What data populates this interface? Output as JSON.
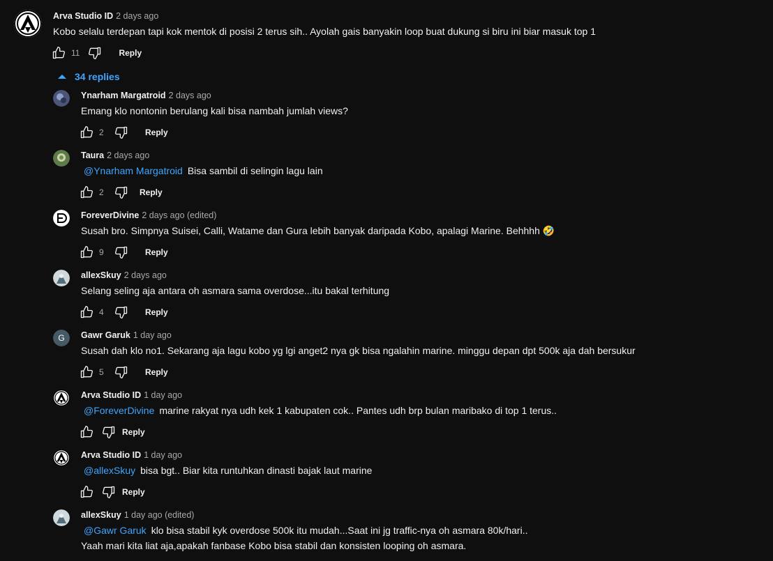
{
  "top_comment": {
    "author": "Arva Studio ID",
    "time": "2 days ago",
    "text": "Kobo selalu terdepan tapi kok mentok di posisi 2 terus sih.. Ayolah gais banyakin loop buat dukung si biru ini biar masuk top 1",
    "likes": "11",
    "reply_label": "Reply"
  },
  "replies_toggle": {
    "label": "34 replies"
  },
  "replies": [
    {
      "author": "Ynarham Margatroid",
      "time": "2 days ago",
      "mention": "",
      "text": "Emang klo nontonin berulang kali bisa nambah jumlah views?",
      "text2": "",
      "likes": "2",
      "reply_label": "Reply"
    },
    {
      "author": "Taura",
      "time": "2 days ago",
      "mention": "@Ynarham Margatroid",
      "text": "Bisa sambil di selingin lagu lain",
      "text2": "",
      "likes": "2",
      "reply_label": "Reply"
    },
    {
      "author": "ForeverDivine",
      "time": "2 days ago (edited)",
      "mention": "",
      "text": "Susah bro. Simpnya Suisei, Calli, Watame dan Gura lebih banyak daripada Kobo, apalagi Marine. Behhhh 🤣",
      "text2": "",
      "likes": "9",
      "reply_label": "Reply"
    },
    {
      "author": "allexSkuy",
      "time": "2 days ago",
      "mention": "",
      "text": "Selang seling aja antara oh asmara sama overdose...itu bakal terhitung",
      "text2": "",
      "likes": "4",
      "reply_label": "Reply"
    },
    {
      "author": "Gawr Garuk",
      "time": "1 day ago",
      "mention": "",
      "text": "Susah dah klo no1. Sekarang aja lagu kobo yg lgi anget2 nya gk bisa ngalahin marine. minggu depan dpt 500k aja dah bersukur",
      "text2": "",
      "likes": "5",
      "reply_label": "Reply"
    },
    {
      "author": "Arva Studio ID",
      "time": "1 day ago",
      "mention": "@ForeverDivine",
      "text": "marine rakyat nya udh kek 1 kabupaten cok.. Pantes udh brp bulan maribako di top 1 terus..",
      "text2": "",
      "likes": "",
      "reply_label": "Reply"
    },
    {
      "author": "Arva Studio ID",
      "time": "1 day ago",
      "mention": "@allexSkuy",
      "text": "bisa bgt.. Biar kita runtuhkan dinasti bajak laut marine",
      "text2": "",
      "likes": "",
      "reply_label": "Reply"
    },
    {
      "author": "allexSkuy",
      "time": "1 day ago (edited)",
      "mention": "@Gawr Garuk",
      "text": "klo bisa stabil kyk overdose 500k itu mudah...Saat ini jg traffic-nya oh asmara 80k/hari..",
      "text2": "Yaah mari kita liat aja,apakah fanbase Kobo bisa stabil dan konsisten looping oh asmara.",
      "likes": "",
      "reply_label": "Reply"
    }
  ],
  "avatar_letters": {
    "gawr": "G"
  },
  "colors": {
    "bg": "#0f0f0f",
    "link": "#3ea6ff",
    "muted": "#aaaaaa",
    "text": "#f1f1f1"
  },
  "icons": [
    "like-icon",
    "dislike-icon",
    "chevron-up-icon"
  ]
}
